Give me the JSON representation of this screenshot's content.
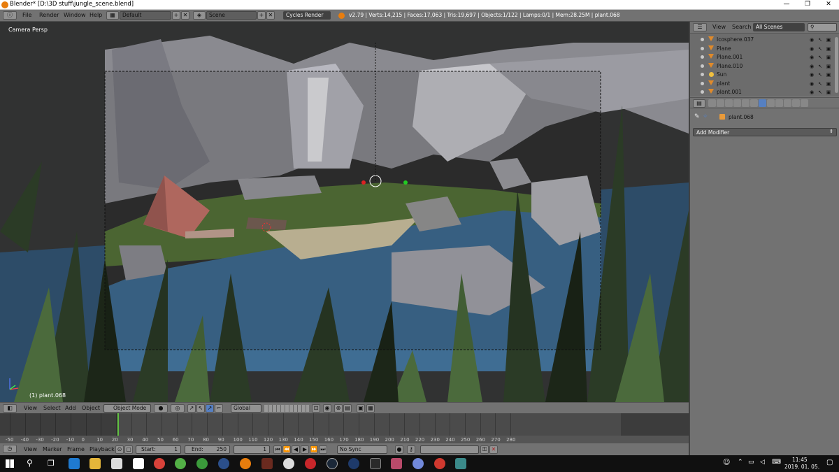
{
  "window": {
    "title": "Blender* [D:\\3D stuff\\jungle_scene.blend]",
    "minimize": "—",
    "maximize": "❐",
    "close": "✕"
  },
  "topbar": {
    "menus": [
      "File",
      "Render",
      "Window",
      "Help"
    ],
    "layout": "Default",
    "scene": "Scene",
    "engine": "Cycles Render",
    "stats": "v2.79 | Verts:14,215 | Faces:17,063 | Tris:19,697 | Objects:1/122 | Lamps:0/1 | Mem:28.25M | plant.068"
  },
  "viewport": {
    "view_label": "Camera Persp",
    "object_label": "(1) plant.068"
  },
  "outliner": {
    "menus": [
      "View",
      "Search"
    ],
    "scene_filter": "All Scenes",
    "rows": [
      {
        "name": "Icosphere.037",
        "type": "mesh"
      },
      {
        "name": "Plane",
        "type": "mesh"
      },
      {
        "name": "Plane.001",
        "type": "mesh"
      },
      {
        "name": "Plane.010",
        "type": "mesh"
      },
      {
        "name": "Sun",
        "type": "lamp"
      },
      {
        "name": "plant",
        "type": "mesh"
      },
      {
        "name": "plant.001",
        "type": "mesh"
      }
    ]
  },
  "properties": {
    "object_name": "plant.068",
    "add_modifier": "Add Modifier"
  },
  "view3d_header": {
    "menus": [
      "View",
      "Select",
      "Add",
      "Object"
    ],
    "mode": "Object Mode",
    "orientation": "Global"
  },
  "timeline": {
    "ticks": [
      "-50",
      "-40",
      "-30",
      "-20",
      "-10",
      "0",
      "10",
      "20",
      "30",
      "40",
      "50",
      "60",
      "70",
      "80",
      "90",
      "100",
      "110",
      "120",
      "130",
      "140",
      "150",
      "160",
      "170",
      "180",
      "190",
      "200",
      "210",
      "220",
      "230",
      "240",
      "250",
      "260",
      "270",
      "280"
    ],
    "current_frame": 0
  },
  "timeline_header": {
    "menus": [
      "View",
      "Marker",
      "Frame",
      "Playback"
    ],
    "start_label": "Start:",
    "start_value": "1",
    "end_label": "End:",
    "end_value": "250",
    "current": "1",
    "sync": "No Sync"
  },
  "taskbar": {
    "time": "11:45",
    "date": "2019. 01. 05."
  },
  "colors": {
    "accent": "#5680c2",
    "panel": "#727272",
    "timeline_cursor": "#60c040"
  }
}
